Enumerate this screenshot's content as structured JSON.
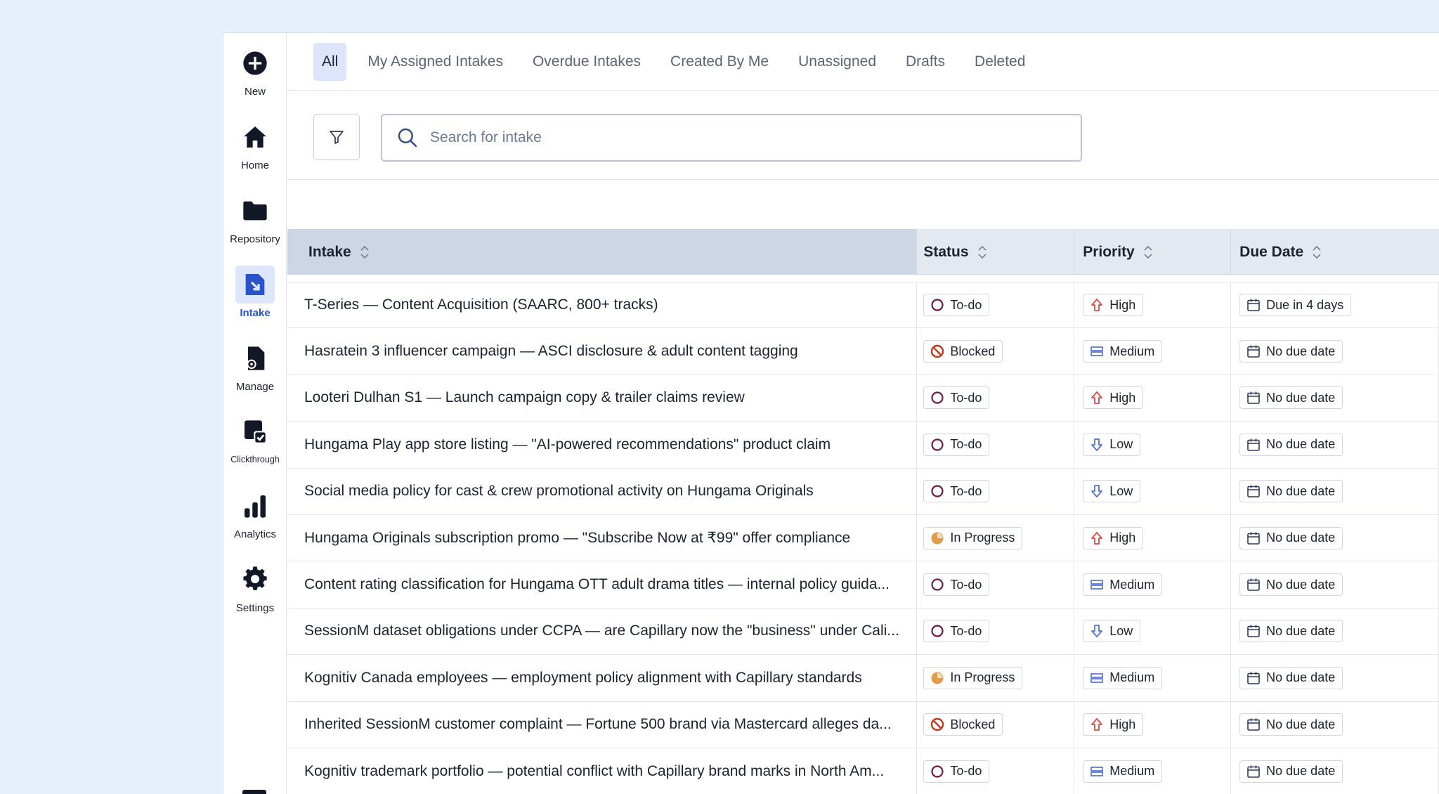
{
  "sidebar": {
    "items": [
      {
        "label": "New",
        "icon": "plus-circle-icon"
      },
      {
        "label": "Home",
        "icon": "home-icon"
      },
      {
        "label": "Repository",
        "icon": "folder-icon"
      },
      {
        "label": "Intake",
        "icon": "intake-icon",
        "active": true
      },
      {
        "label": "Manage",
        "icon": "manage-icon"
      },
      {
        "label": "Clickthrough",
        "icon": "clickthrough-icon"
      },
      {
        "label": "Analytics",
        "icon": "bar-chart-icon"
      },
      {
        "label": "Settings",
        "icon": "gear-icon"
      }
    ]
  },
  "tabs": [
    {
      "label": "All",
      "active": true
    },
    {
      "label": "My Assigned Intakes"
    },
    {
      "label": "Overdue Intakes"
    },
    {
      "label": "Created By Me"
    },
    {
      "label": "Unassigned"
    },
    {
      "label": "Drafts"
    },
    {
      "label": "Deleted"
    }
  ],
  "search": {
    "placeholder": "Search for intake"
  },
  "table": {
    "columns": [
      "Intake",
      "Status",
      "Priority",
      "Due Date"
    ],
    "rows": [
      {
        "intake": "T-Series — Content Acquisition (SAARC, 800+ tracks)",
        "status": "To-do",
        "priority": "High",
        "due": "Due in 4 days"
      },
      {
        "intake": "Hasratein 3 influencer campaign — ASCI disclosure & adult content tagging",
        "status": "Blocked",
        "priority": "Medium",
        "due": "No due date"
      },
      {
        "intake": "Looteri Dulhan S1 — Launch campaign copy & trailer claims review",
        "status": "To-do",
        "priority": "High",
        "due": "No due date"
      },
      {
        "intake": "Hungama Play app store listing — \"AI-powered recommendations\" product claim",
        "status": "To-do",
        "priority": "Low",
        "due": "No due date"
      },
      {
        "intake": "Social media policy for cast & crew promotional activity on Hungama Originals",
        "status": "To-do",
        "priority": "Low",
        "due": "No due date"
      },
      {
        "intake": "Hungama Originals subscription promo — \"Subscribe Now at ₹99\" offer compliance",
        "status": "In Progress",
        "priority": "High",
        "due": "No due date"
      },
      {
        "intake": "Content rating classification for Hungama OTT adult drama titles — internal policy guida...",
        "status": "To-do",
        "priority": "Medium",
        "due": "No due date"
      },
      {
        "intake": "SessionM dataset obligations under CCPA — are Capillary now the \"business\" under Cali...",
        "status": "To-do",
        "priority": "Low",
        "due": "No due date"
      },
      {
        "intake": "Kognitiv Canada employees — employment policy alignment with Capillary standards",
        "status": "In Progress",
        "priority": "Medium",
        "due": "No due date"
      },
      {
        "intake": "Inherited SessionM customer complaint — Fortune 500 brand via Mastercard alleges da...",
        "status": "Blocked",
        "priority": "High",
        "due": "No due date"
      },
      {
        "intake": "Kognitiv trademark portfolio — potential conflict with Capillary brand marks in North Am...",
        "status": "To-do",
        "priority": "Medium",
        "due": "No due date"
      }
    ]
  },
  "colors": {
    "accent": "#2a52c9",
    "todo": "#6b1f3a",
    "blocked": "#c0391b",
    "in_progress": "#e09c4c",
    "high": "#e04848",
    "medium": "#5472d3",
    "low": "#5472d3"
  }
}
